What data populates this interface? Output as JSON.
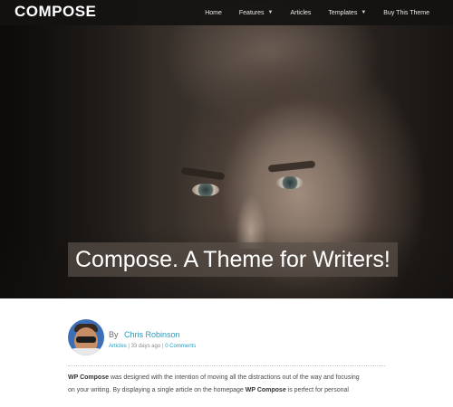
{
  "header": {
    "logo": "COMPOSE",
    "nav": [
      {
        "label": "Home",
        "has_dropdown": false
      },
      {
        "label": "Features",
        "has_dropdown": true
      },
      {
        "label": "Articles",
        "has_dropdown": false
      },
      {
        "label": "Templates",
        "has_dropdown": true
      },
      {
        "label": "Buy This Theme",
        "has_dropdown": false
      }
    ],
    "dropdown_icon": "chevron-down-icon"
  },
  "hero": {
    "title": "Compose. A Theme for Writers!",
    "image": "portrait of a weathered man's face"
  },
  "author": {
    "by": "By",
    "name": "Chris Robinson"
  },
  "meta": {
    "category": "Articles",
    "sep": "|",
    "time": "33 days ago",
    "comments": "0 Comments"
  },
  "body": {
    "brand": "WP Compose",
    "line1_rest": " was designed with the intention of moving all the distractions out of the way and focusing",
    "line2_start": "on your writing. By displaying a single article on the homepage ",
    "line2_end": " is perfect for personal"
  },
  "colors": {
    "link": "#2a9ab8",
    "navbar": "#141211"
  }
}
